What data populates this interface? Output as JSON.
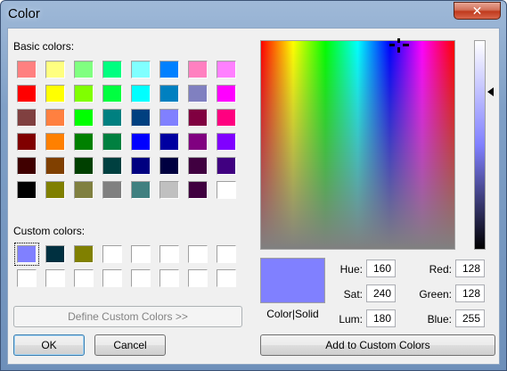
{
  "window": {
    "title": "Color",
    "close_glyph": "✕"
  },
  "basic_colors": {
    "label": "Basic colors:",
    "swatches": [
      "#ff8080",
      "#ffff80",
      "#80ff80",
      "#00ff80",
      "#80ffff",
      "#0080ff",
      "#ff80c0",
      "#ff80ff",
      "#ff0000",
      "#ffff00",
      "#80ff00",
      "#00ff40",
      "#00ffff",
      "#0080c0",
      "#8080c0",
      "#ff00ff",
      "#804040",
      "#ff8040",
      "#00ff00",
      "#008080",
      "#004080",
      "#8080ff",
      "#800040",
      "#ff0080",
      "#800000",
      "#ff8000",
      "#008000",
      "#008040",
      "#0000ff",
      "#0000a0",
      "#800080",
      "#8000ff",
      "#400000",
      "#804000",
      "#004000",
      "#004040",
      "#000080",
      "#000040",
      "#400040",
      "#400080",
      "#000000",
      "#808000",
      "#808040",
      "#808080",
      "#408080",
      "#c0c0c0",
      "#400040",
      "#ffffff"
    ]
  },
  "custom_colors": {
    "label": "Custom colors:",
    "swatches": [
      "#8080ff",
      "#003040",
      "#808000",
      "#ffffff",
      "#ffffff",
      "#ffffff",
      "#ffffff",
      "#ffffff",
      "#ffffff",
      "#ffffff",
      "#ffffff",
      "#ffffff",
      "#ffffff",
      "#ffffff",
      "#ffffff",
      "#ffffff"
    ],
    "selected_index": 0
  },
  "define_button": "Define Custom Colors >>",
  "ok_button": "OK",
  "cancel_button": "Cancel",
  "preview": {
    "color": "#8080ff",
    "label": "Color|Solid"
  },
  "fields": {
    "hue": {
      "label": "Hue:",
      "value": "160"
    },
    "sat": {
      "label": "Sat:",
      "value": "240"
    },
    "lum": {
      "label": "Lum:",
      "value": "180"
    },
    "red": {
      "label": "Red:",
      "value": "128"
    },
    "green": {
      "label": "Green:",
      "value": "128"
    },
    "blue": {
      "label": "Blue:",
      "value": "255"
    }
  },
  "add_button": "Add to Custom Colors"
}
